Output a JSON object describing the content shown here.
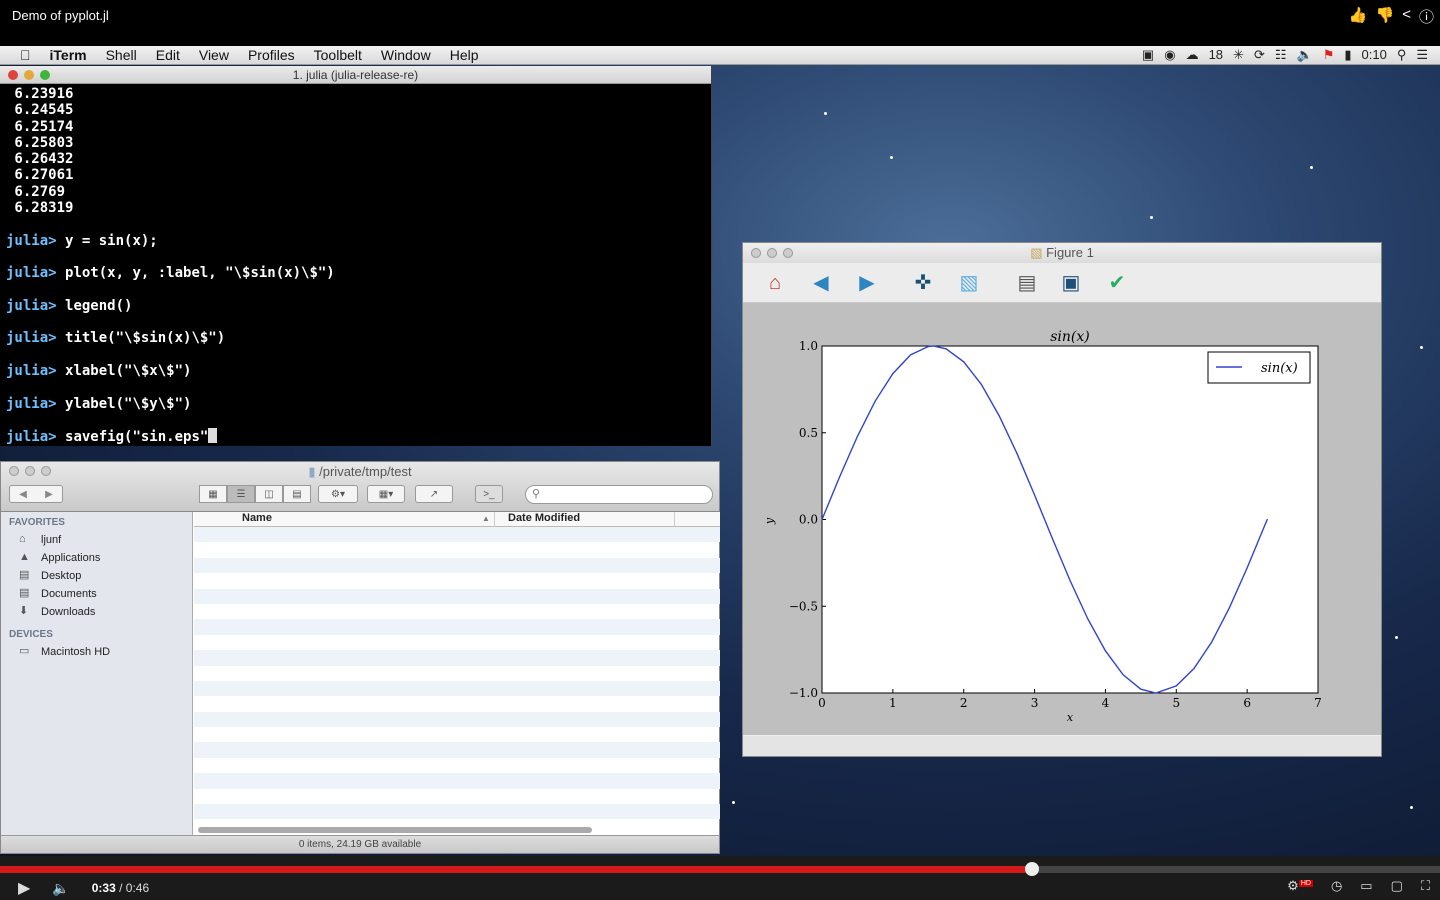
{
  "video": {
    "title": "Demo of pyplot.jl",
    "time_current": "0:33",
    "time_sep": " / ",
    "time_total": "0:46",
    "progress": 0.717,
    "hd_badge": "HD"
  },
  "menubar": {
    "apple": "",
    "items": [
      "iTerm",
      "Shell",
      "Edit",
      "View",
      "Profiles",
      "Toolbelt",
      "Window",
      "Help"
    ],
    "clock": "0:10",
    "tray_badge": "18"
  },
  "terminal": {
    "title": "1. julia (julia-release-re)",
    "lines": [
      {
        "text": " 6.23916"
      },
      {
        "text": " 6.24545"
      },
      {
        "text": " 6.25174"
      },
      {
        "text": " 6.25803"
      },
      {
        "text": " 6.26432"
      },
      {
        "text": " 6.27061"
      },
      {
        "text": " 6.2769"
      },
      {
        "text": " 6.28319"
      },
      {
        "text": ""
      },
      {
        "prompt": "julia> ",
        "text": "y = sin(x);"
      },
      {
        "text": ""
      },
      {
        "prompt": "julia> ",
        "text": "plot(x, y, :label, \"\\$sin(x)\\$\")"
      },
      {
        "text": ""
      },
      {
        "prompt": "julia> ",
        "text": "legend()"
      },
      {
        "text": ""
      },
      {
        "prompt": "julia> ",
        "text": "title(\"\\$sin(x)\\$\")"
      },
      {
        "text": ""
      },
      {
        "prompt": "julia> ",
        "text": "xlabel(\"\\$x\\$\")"
      },
      {
        "text": ""
      },
      {
        "prompt": "julia> ",
        "text": "ylabel(\"\\$y\\$\")"
      },
      {
        "text": ""
      },
      {
        "prompt": "julia> ",
        "text": "savefig(\"sin.eps\"",
        "cursor": true
      }
    ]
  },
  "finder": {
    "path": "/private/tmp/test",
    "search_placeholder": "",
    "favorites_header": "FAVORITES",
    "devices_header": "DEVICES",
    "favorites": [
      {
        "label": "ljunf",
        "icon": "home-icon"
      },
      {
        "label": "Applications",
        "icon": "applications-icon"
      },
      {
        "label": "Desktop",
        "icon": "desktop-icon"
      },
      {
        "label": "Documents",
        "icon": "documents-icon"
      },
      {
        "label": "Downloads",
        "icon": "downloads-icon"
      }
    ],
    "devices": [
      {
        "label": "Macintosh HD",
        "icon": "harddisk-icon"
      }
    ],
    "columns": {
      "name": "Name",
      "date": "Date Modified"
    },
    "status": "0 items, 24.19 GB available"
  },
  "figure": {
    "window_title": "Figure 1",
    "toolbar": [
      {
        "name": "home-icon",
        "glyph": "⌂",
        "color": "#c0392b"
      },
      {
        "name": "back-icon",
        "glyph": "◀",
        "color": "#2e86c1"
      },
      {
        "name": "forward-icon",
        "glyph": "▶",
        "color": "#2e86c1"
      },
      {
        "name": "pan-icon",
        "glyph": "✜",
        "color": "#1a5276"
      },
      {
        "name": "zoom-icon",
        "glyph": "▧",
        "color": "#5dade2"
      },
      {
        "name": "subplots-icon",
        "glyph": "▤",
        "color": "#555"
      },
      {
        "name": "save-icon",
        "glyph": "▣",
        "color": "#1f4e79"
      },
      {
        "name": "edit-icon",
        "glyph": "✔",
        "color": "#27ae60"
      }
    ]
  },
  "chart_data": {
    "type": "line",
    "title": "sin(x)",
    "xlabel": "x",
    "ylabel": "y",
    "xlim": [
      0,
      7
    ],
    "ylim": [
      -1.0,
      1.0
    ],
    "xticks": [
      "0",
      "1",
      "2",
      "3",
      "4",
      "5",
      "6",
      "7"
    ],
    "yticks": [
      "1.0",
      "0.5",
      "0.0",
      "−0.5",
      "−1.0"
    ],
    "legend": "top-right",
    "grid": false,
    "series": [
      {
        "name": "sin(x)",
        "color": "#3344cc",
        "x": [
          0,
          0.25,
          0.5,
          0.75,
          1,
          1.25,
          1.5,
          1.5708,
          1.75,
          2,
          2.25,
          2.5,
          2.75,
          3,
          3.1416,
          3.25,
          3.5,
          3.75,
          4,
          4.25,
          4.5,
          4.7124,
          5,
          5.25,
          5.5,
          5.75,
          6,
          6.2832
        ],
        "y": [
          0,
          0.247,
          0.479,
          0.682,
          0.841,
          0.949,
          0.997,
          1.0,
          0.984,
          0.909,
          0.778,
          0.598,
          0.382,
          0.141,
          0,
          -0.108,
          -0.351,
          -0.572,
          -0.757,
          -0.895,
          -0.978,
          -1.0,
          -0.959,
          -0.859,
          -0.706,
          -0.508,
          -0.279,
          0
        ]
      }
    ]
  }
}
